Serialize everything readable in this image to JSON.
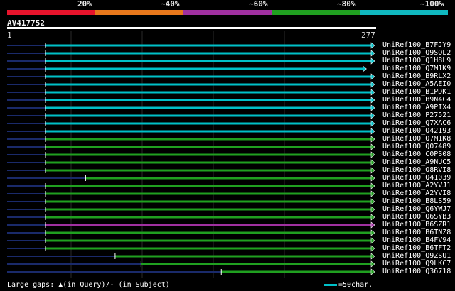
{
  "legend": [
    {
      "label": "20%",
      "color": "#e8142c"
    },
    {
      "label": "~40%",
      "color": "#e8781c"
    },
    {
      "label": "~60%",
      "color": "#a030a0"
    },
    {
      "label": "~80%",
      "color": "#20a020"
    },
    {
      "label": "~100%",
      "color": "#10b8c0"
    }
  ],
  "query": {
    "name": "AV417752",
    "start_label": "1",
    "end_label": "277",
    "length": 277
  },
  "hits": [
    {
      "name": "UniRef100_B7FJY9",
      "color": "#00c0c8",
      "start": 1,
      "end": 277
    },
    {
      "name": "UniRef100_Q9SQL2",
      "color": "#00c0c8",
      "start": 1,
      "end": 277
    },
    {
      "name": "UniRef100_Q1H8L9",
      "color": "#00c0c8",
      "start": 1,
      "end": 277
    },
    {
      "name": "UniRef100_Q7M1K9",
      "color": "#00c0c8",
      "start": 1,
      "end": 270
    },
    {
      "name": "UniRef100_B9RLX2",
      "color": "#00c0c8",
      "start": 1,
      "end": 277
    },
    {
      "name": "UniRef100_A5AEI0",
      "color": "#00c0c8",
      "start": 1,
      "end": 277
    },
    {
      "name": "UniRef100_B1PDK1",
      "color": "#00c0c8",
      "start": 1,
      "end": 277
    },
    {
      "name": "UniRef100_B9N4C4",
      "color": "#00c0c8",
      "start": 1,
      "end": 277
    },
    {
      "name": "UniRef100_A9PIX4",
      "color": "#00c0c8",
      "start": 1,
      "end": 277
    },
    {
      "name": "UniRef100_P27521",
      "color": "#00c0c8",
      "start": 1,
      "end": 277
    },
    {
      "name": "UniRef100_Q7XAC6",
      "color": "#00c0c8",
      "start": 1,
      "end": 277
    },
    {
      "name": "UniRef100_Q42193",
      "color": "#00c0c8",
      "start": 1,
      "end": 277
    },
    {
      "name": "UniRef100_Q7M1K8",
      "color": "#20a020",
      "start": 1,
      "end": 277
    },
    {
      "name": "UniRef100_Q07489",
      "color": "#20a020",
      "start": 1,
      "end": 277
    },
    {
      "name": "UniRef100_C0PS08",
      "color": "#20a020",
      "start": 1,
      "end": 277
    },
    {
      "name": "UniRef100_A9NUC5",
      "color": "#20a020",
      "start": 1,
      "end": 277
    },
    {
      "name": "UniRef100_Q8RVI8",
      "color": "#20a020",
      "start": 1,
      "end": 277
    },
    {
      "name": "UniRef100_Q41039",
      "color": "#20a020",
      "start": 35,
      "end": 277
    },
    {
      "name": "UniRef100_A2YVJ1",
      "color": "#20a020",
      "start": 1,
      "end": 277
    },
    {
      "name": "UniRef100_A2YVI8",
      "color": "#20a020",
      "start": 1,
      "end": 277
    },
    {
      "name": "UniRef100_B8LS59",
      "color": "#20a020",
      "start": 1,
      "end": 277
    },
    {
      "name": "UniRef100_Q6YWJ7",
      "color": "#20a020",
      "start": 1,
      "end": 277
    },
    {
      "name": "UniRef100_Q6SYB3",
      "color": "#20a020",
      "start": 1,
      "end": 277
    },
    {
      "name": "UniRef100_B6SZR1",
      "color": "#a030a0",
      "start": 1,
      "end": 277
    },
    {
      "name": "UniRef100_B6TNZ8",
      "color": "#20a020",
      "start": 1,
      "end": 277
    },
    {
      "name": "UniRef100_B4FV94",
      "color": "#20a020",
      "start": 1,
      "end": 277
    },
    {
      "name": "UniRef100_B6TFT2",
      "color": "#20a020",
      "start": 1,
      "end": 277
    },
    {
      "name": "UniRef100_Q9ZSU1",
      "color": "#20a020",
      "start": 60,
      "end": 277
    },
    {
      "name": "UniRef100_Q9LKC7",
      "color": "#20a020",
      "start": 82,
      "end": 277
    },
    {
      "name": "UniRef100_Q36718",
      "color": "#20a020",
      "start": 150,
      "end": 277
    }
  ],
  "footer": {
    "left_text": "Large gaps: ▲(in Query)/- (in Subject)",
    "right_text": "=50char."
  }
}
